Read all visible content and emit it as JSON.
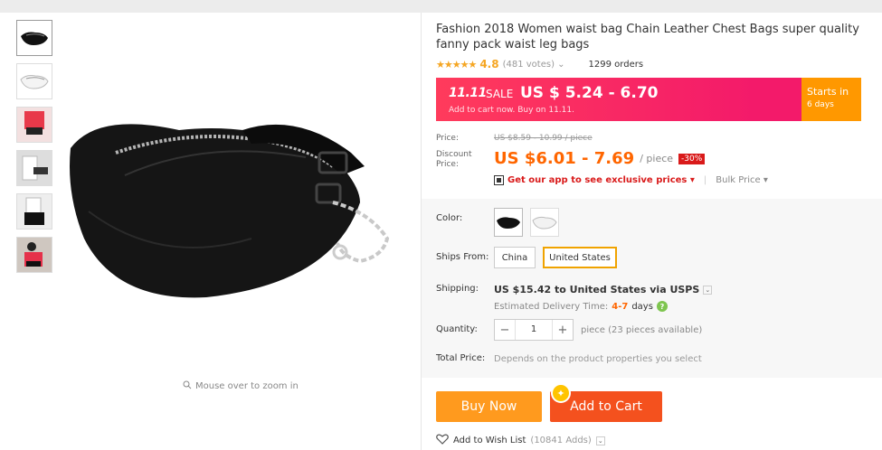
{
  "product": {
    "title": "Fashion 2018 Women waist bag Chain Leather Chest Bags super quality fanny pack waist leg bags",
    "stars": "★★★★★",
    "rating": "4.8",
    "votes": "(481 votes)",
    "votes_chevron": "⌄",
    "orders": "1299 orders"
  },
  "gallery": {
    "zoom_hint": "Mouse over to zoom in",
    "thumbs": [
      "black-bag",
      "white-bag",
      "red-outfit",
      "model-1",
      "model-2",
      "model-3"
    ]
  },
  "sale": {
    "tag": "11.11",
    "label": "SALE",
    "price": "US $ 5.24 - 6.70",
    "note": "Add to cart now. Buy on 11.11.",
    "starts_label": "Starts in",
    "starts_days": "6 days"
  },
  "pricing": {
    "price_label": "Price:",
    "original": "US $8.59 - 10.99 / piece",
    "discount_label_1": "Discount",
    "discount_label_2": "Price:",
    "discount_price": "US $6.01 - 7.69",
    "per": "/ piece",
    "off": "-30%",
    "app_text": "Get our app to see exclusive prices",
    "app_chevron": "▾",
    "bulk": "Bulk Price",
    "bulk_chevron": "▾"
  },
  "options": {
    "color_label": "Color:",
    "ships_from_label": "Ships From:",
    "ships_from": [
      "China",
      "United States"
    ],
    "selected_ship": "United States",
    "shipping_label": "Shipping:",
    "shipping_value": "US $15.42 to United States via USPS",
    "shipping_chevron": "⌄",
    "delivery_label": "Estimated Delivery Time:",
    "delivery_days": "4-7",
    "delivery_unit": "days",
    "delivery_help": "?",
    "quantity_label": "Quantity:",
    "quantity_value": "1",
    "minus": "−",
    "plus": "+",
    "available": "piece (23 pieces available)",
    "total_label": "Total Price:",
    "total_value": "Depends on the product properties you select"
  },
  "actions": {
    "buy_now": "Buy Now",
    "add_to_cart": "Add to Cart",
    "badge": "✦",
    "wishlist": "Add to Wish List",
    "wishlist_count": "(10841 Adds)",
    "wish_chevron": "⌄"
  },
  "colors": {
    "accent_orange": "#ff9a1e",
    "cart_red": "#f4511e",
    "sale_pink": "#f31a6a",
    "price_orange": "#ff6600"
  }
}
